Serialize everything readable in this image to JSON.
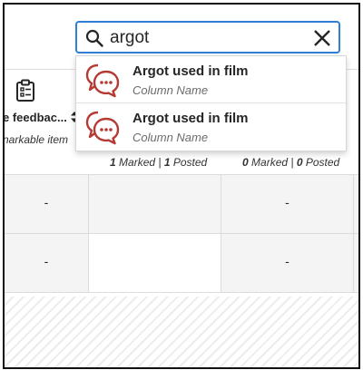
{
  "search": {
    "value": "argot",
    "placeholder": ""
  },
  "column_header": {
    "title": "e feedbac...",
    "subtitle": "narkable item"
  },
  "suggestions": [
    {
      "title": "Argot used in film",
      "subtitle": "Column Name"
    },
    {
      "title": "Argot used in film",
      "subtitle": "Column Name"
    }
  ],
  "grid": {
    "headers": [
      {
        "marked": "1",
        "marked_label": " Marked | ",
        "posted": "1",
        "posted_label": " Posted"
      },
      {
        "marked": "0",
        "marked_label": " Marked | ",
        "posted": "0",
        "posted_label": " Posted"
      }
    ],
    "rows": [
      {
        "cells": [
          "-",
          "",
          "-",
          ""
        ]
      },
      {
        "cells": [
          "-",
          "",
          "-",
          ""
        ]
      }
    ]
  },
  "colors": {
    "accent": "#2f7fd8",
    "icon_red": "#b53a33"
  },
  "icons": {
    "search": "search-icon",
    "clear": "close-icon",
    "clipboard": "clipboard-icon",
    "sort": "sort-icon",
    "suggestion": "discussion-icon"
  }
}
